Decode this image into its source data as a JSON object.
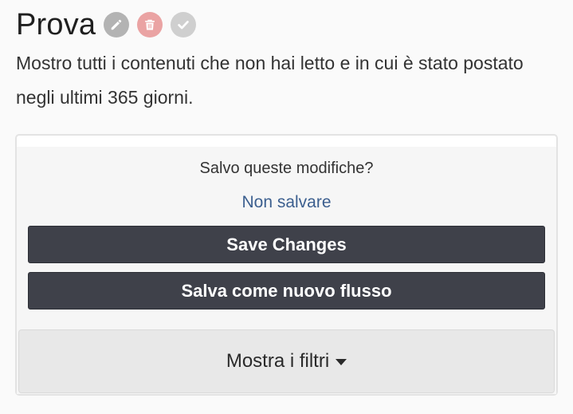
{
  "header": {
    "title": "Prova",
    "icons": [
      "pencil-icon",
      "trash-icon",
      "check-icon"
    ]
  },
  "description": "Mostro tutti i contenuti che non hai letto e in cui è stato postato negli ultimi 365 giorni.",
  "save_panel": {
    "question": "Salvo queste modifiche?",
    "discard_label": "Non salvare",
    "save_label": "Save Changes",
    "save_new_label": "Salva come nuovo flusso",
    "filters_label": "Mostra i filtri"
  },
  "colors": {
    "button_bg": "#3f414a",
    "link": "#3c5f8f",
    "delete_icon_bg": "#eaa3a3"
  }
}
